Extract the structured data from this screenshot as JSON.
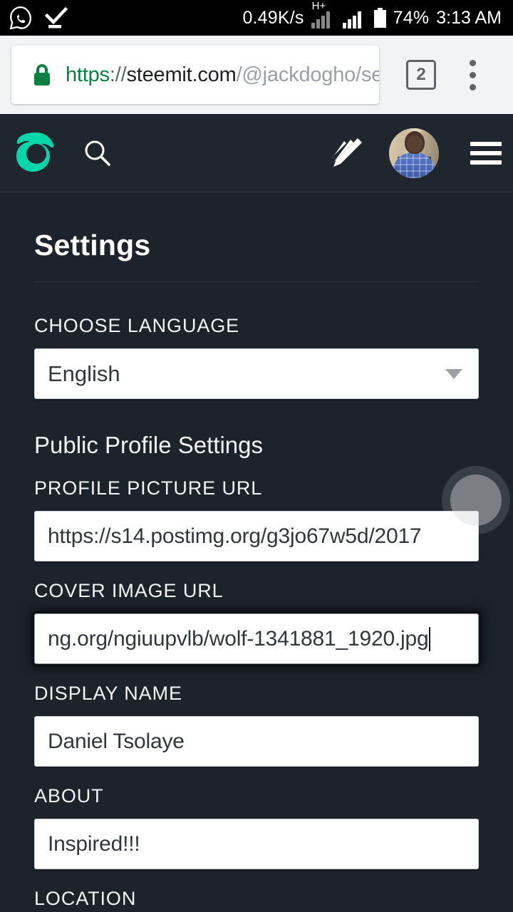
{
  "statusbar": {
    "whatsapp_icon": "whatsapp-icon",
    "check_icon": "checkmark-icon",
    "network_speed": "0.49K/s",
    "network_type": "H+",
    "battery_percent": "74%",
    "time": "3:13 AM"
  },
  "browser": {
    "lock_icon": "lock-icon",
    "url": {
      "scheme": "https",
      "separator": "://",
      "host": "steemit.com",
      "path": "/@jackdogho/se"
    },
    "tab_count": "2",
    "menu_icon": "kebab-menu-icon",
    "accent_secure": "#0b8043",
    "bar_background": "#f1f3f4"
  },
  "appheader": {
    "logo_icon": "steemit-logo-icon",
    "logo_color": "#06d6a9",
    "search_icon": "search-icon",
    "compose_icon": "pencil-icon",
    "avatar": "user-avatar",
    "menu_icon": "hamburger-menu-icon",
    "background": "#1f262e"
  },
  "main": {
    "page_title": "Settings",
    "language": {
      "label": "CHOOSE LANGUAGE",
      "selected": "English",
      "options": [
        "English"
      ],
      "dropdown_icon": "chevron-down-icon"
    },
    "profile_section": {
      "heading": "Public Profile Settings",
      "fields": [
        {
          "label": "PROFILE PICTURE URL",
          "value": "https://s14.postimg.org/g3jo67w5d/2017",
          "focused": false
        },
        {
          "label": "COVER IMAGE URL",
          "value": "ng.org/ngiuupvlb/wolf-1341881_1920.jpg",
          "focused": true
        },
        {
          "label": "DISPLAY NAME",
          "value": "Daniel Tsolaye",
          "focused": false
        },
        {
          "label": "ABOUT",
          "value": "Inspired!!!",
          "focused": false
        },
        {
          "label": "LOCATION",
          "value": "",
          "focused": false
        }
      ]
    },
    "background": "#1c232b",
    "text_color": "#f2f4f6"
  },
  "overlay": {
    "floating_button": "floating-assistive-button"
  }
}
